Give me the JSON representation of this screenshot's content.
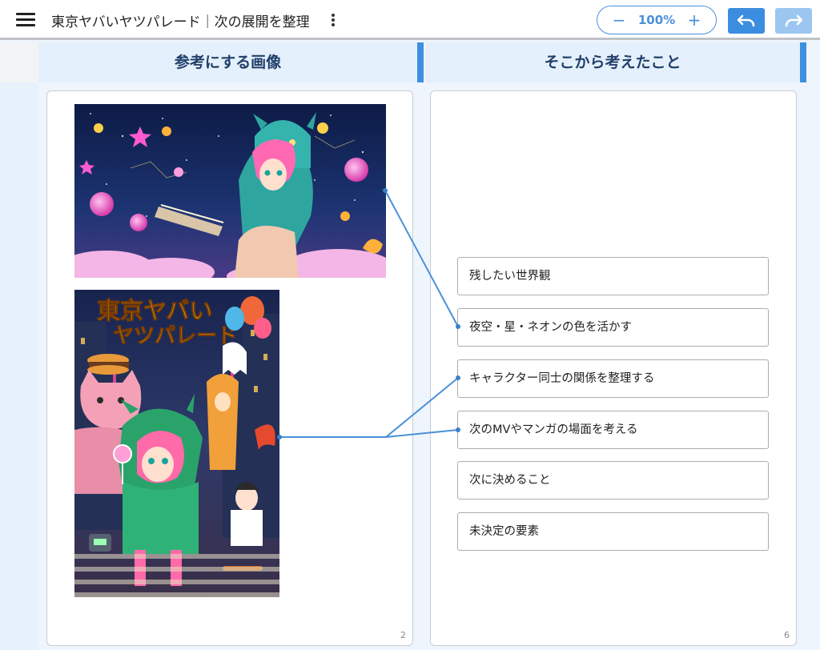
{
  "toolbar": {
    "title": "東京ヤバいヤツパレード｜次の展開を整理",
    "zoom_minus": "−",
    "zoom_level": "100%",
    "zoom_plus": "+"
  },
  "columns": {
    "left_header": "参考にする画像",
    "right_header": "そこから考えたこと"
  },
  "panels": {
    "left_page": "2",
    "right_page": "6"
  },
  "poster": {
    "title_line1": "東京ヤバい",
    "title_line2": "ヤツパレード"
  },
  "ideas": [
    {
      "label": "残したい世界観"
    },
    {
      "label": "夜空・星・ネオンの色を活かす"
    },
    {
      "label": "キャラクター同士の関係を整理する"
    },
    {
      "label": "次のMVやマンガの場面を考える"
    },
    {
      "label": "次に決めること"
    },
    {
      "label": "未決定の要素"
    }
  ],
  "colors": {
    "accent": "#3f8fe0",
    "header_text": "#21406b",
    "connector": "#4a90d9"
  },
  "icons": {
    "menu": "hamburger-icon",
    "more": "more-vertical-icon",
    "undo": "undo-icon",
    "redo": "redo-icon"
  }
}
